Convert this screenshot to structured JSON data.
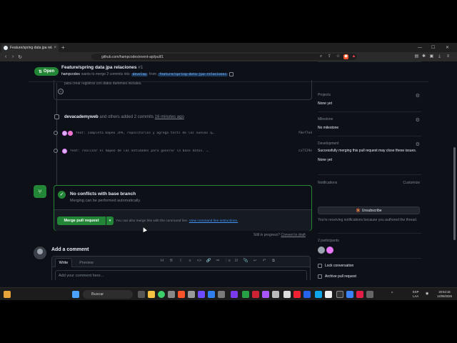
{
  "browser": {
    "tab_title": "Feature/spring data jpa relacio…",
    "tab_close": "×",
    "new_tab": "+",
    "url": "github.com/hampcodes/event-api/pull/1",
    "min": "—",
    "max": "☐",
    "close": "✕"
  },
  "pr": {
    "state": "Open",
    "title": "Feature/spring data jpa relaciones",
    "number": "#1",
    "author": "hampcodes",
    "sub_text": "wants to merge 2 commits into",
    "base_branch": "develop",
    "from_text": "from",
    "head_branch": "feature/spring-data-jpa-relaciones"
  },
  "timeline": {
    "cut_text": "para crear registros con datos dummies iniciales.",
    "added_user": "devacademyweb",
    "added_text": "and others added 2 commits",
    "added_time": "16 minutes ago",
    "commits": [
      {
        "message": "feat: completa mapeo JPA, repositorios y agrega tests de las nuevas q…",
        "sha": "f8ef7ed"
      },
      {
        "message": "feat: realizar el mapeo de las entidades para generar la base datos. …",
        "sha": "ca7I29e"
      }
    ]
  },
  "merge": {
    "title": "No conflicts with base branch",
    "subtitle": "Merging can be performed automatically.",
    "button": "Merge pull request",
    "caret": "▾",
    "hint": "You can also merge this with the command line.",
    "hint_link": "View command line instructions.",
    "still": "Still in progress?",
    "convert": "Convert to draft"
  },
  "comment": {
    "heading": "Add a comment",
    "tab_write": "Write",
    "tab_preview": "Preview",
    "placeholder": "Add your comment here...",
    "tools": [
      "H",
      "B",
      "I",
      "≡",
      "<>",
      "🔗",
      "≔",
      "⋮≡",
      "☑",
      "📎",
      "↩",
      "↶",
      "⧉"
    ]
  },
  "sidebar": {
    "projects_label": "Projects",
    "projects_value": "None yet",
    "milestone_label": "Milestone",
    "milestone_value": "No milestone",
    "development_label": "Development",
    "development_text": "Successfully merging this pull request may close these issues.",
    "development_value": "None yet",
    "notifications_label": "Notifications",
    "customize": "Customize",
    "unsubscribe": "Unsubscribe",
    "notif_text": "You're receiving notifications because you authored the thread.",
    "participants": "2 participants",
    "lock": "Lock conversation",
    "archive": "Archive pull request"
  },
  "taskbar": {
    "search": "Buscar",
    "lang": "ESP",
    "region": "LAA",
    "time": "20:53:18",
    "date": "14/09/2026"
  }
}
